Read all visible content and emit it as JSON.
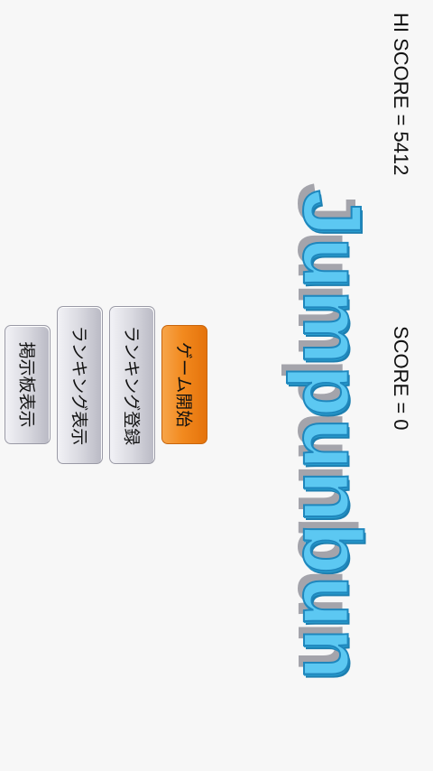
{
  "header": {
    "hi_score": "HI SCORE = 5412",
    "score": "SCORE = 0"
  },
  "logo": {
    "title": "Jumpunbun"
  },
  "menu": {
    "start_label": "ゲーム開始",
    "register_label": "ランキング登録",
    "ranking_label": "ランキング表示",
    "board_label": "掲示板表示"
  },
  "colors": {
    "background": "#f7f7f7",
    "logo_blue": "#5cc8f2",
    "start_orange": "#f28a1f",
    "button_gray": "#d9d9e0"
  }
}
